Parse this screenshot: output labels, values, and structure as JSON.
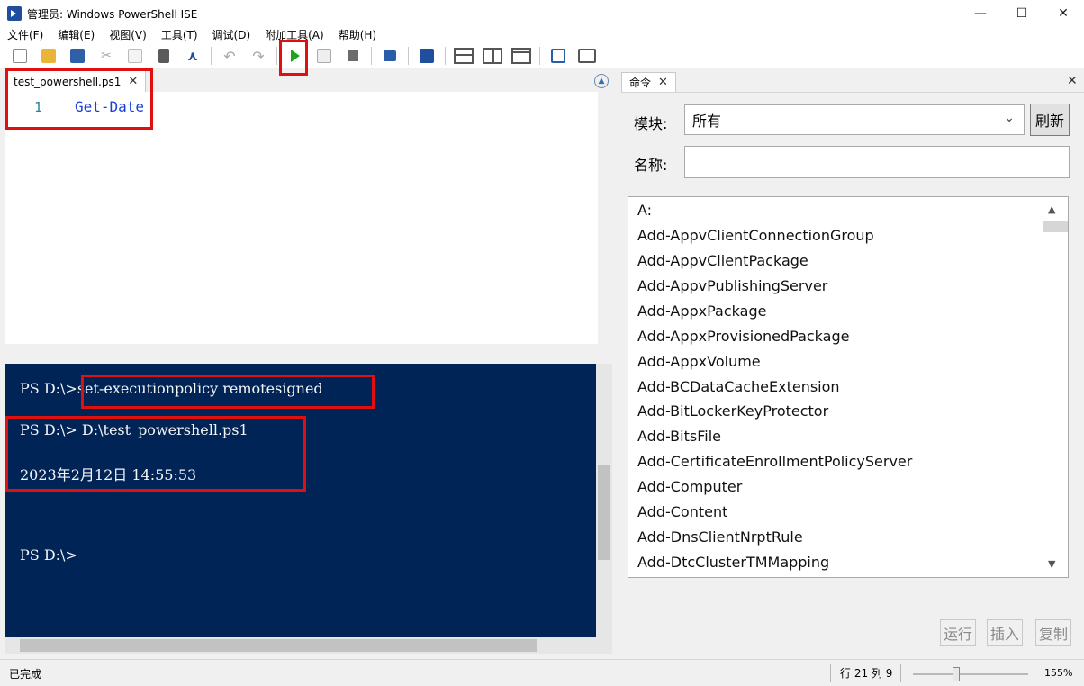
{
  "window": {
    "title": "管理员: Windows PowerShell ISE",
    "minimize": "—",
    "maximize": "☐",
    "close": "✕"
  },
  "menu": [
    "文件(F)",
    "编辑(E)",
    "视图(V)",
    "工具(T)",
    "调试(D)",
    "附加工具(A)",
    "帮助(H)"
  ],
  "editor": {
    "tab_label": "test_powershell.ps1",
    "tab_close": "✕",
    "line_number": "1",
    "code": "Get-Date"
  },
  "console": {
    "lines": [
      "PS D:\\> set-executionpolicy remotesigned",
      "PS D:\\> D:\\test_powershell.ps1",
      "2023年2月12日 14:55:53",
      "PS D:\\>"
    ],
    "prompt": "PS D:\\>",
    "cmd1": "set-executionpolicy remotesigned"
  },
  "commands_pane": {
    "tab_label": "命令",
    "tab_close": "✕",
    "pane_close": "✕",
    "module_label": "模块:",
    "module_value": "所有",
    "refresh": "刷新",
    "name_label": "名称:",
    "name_value": "",
    "items": [
      "A:",
      "Add-AppvClientConnectionGroup",
      "Add-AppvClientPackage",
      "Add-AppvPublishingServer",
      "Add-AppxPackage",
      "Add-AppxProvisionedPackage",
      "Add-AppxVolume",
      "Add-BCDataCacheExtension",
      "Add-BitLockerKeyProtector",
      "Add-BitsFile",
      "Add-CertificateEnrollmentPolicyServer",
      "Add-Computer",
      "Add-Content",
      "Add-DnsClientNrptRule",
      "Add-DtcClusterTMMapping"
    ],
    "run": "运行",
    "insert": "插入",
    "copy": "复制"
  },
  "status": {
    "text": "已完成",
    "position": "行 21 列 9",
    "zoom": "155%"
  },
  "colors": {
    "console_bg": "#012456",
    "keyword": "#1a3fd6",
    "highlight": "#e01010"
  }
}
